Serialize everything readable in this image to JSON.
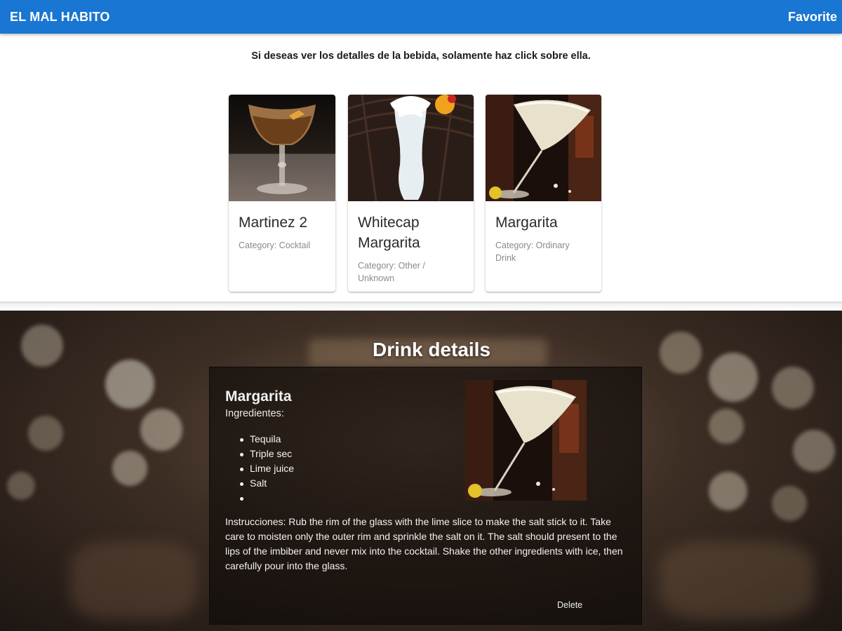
{
  "app_bar": {
    "brand": "EL MAL HABITO",
    "favorite_label": "Favorite"
  },
  "instruction": "Si deseas ver los detalles de la bebida, solamente haz click sobre ella.",
  "drinks": [
    {
      "name": "Martinez 2",
      "category": "Category: Cocktail"
    },
    {
      "name": "Whitecap Margarita",
      "category": "Category: Other / Unknown"
    },
    {
      "name": "Margarita",
      "category": "Category: Ordinary Drink"
    }
  ],
  "details": {
    "heading": "Drink details",
    "name": "Margarita",
    "ingredients_label": "Ingredientes:",
    "ingredients": [
      "Tequila",
      "Triple sec",
      "Lime juice",
      "Salt",
      ""
    ],
    "instructions": "Instrucciones: Rub the rim of the glass with the lime slice to make the salt stick to it. Take care to moisten only the outer rim and sprinkle the salt on it. The salt should present to the lips of the imbiber and never mix into the cocktail. Shake the other ingredients with ice, then carefully pour into the glass.",
    "delete_label": "Delete"
  },
  "colors": {
    "app_bar": "#1976d2",
    "panel": "#0c0806"
  }
}
